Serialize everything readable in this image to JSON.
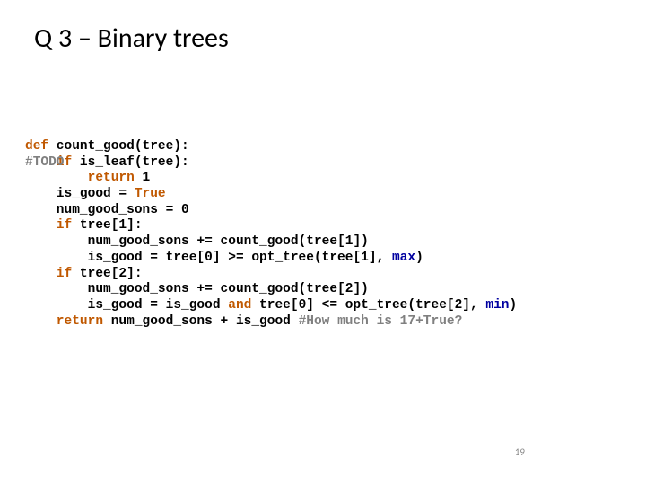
{
  "title": "Q 3 – Binary trees",
  "code": {
    "l1_def": "def",
    "l1_rest": " count_good(tree):",
    "l2_kw": "    if",
    "l2_rest": " is_leaf(tree):",
    "l2_overlay": "    #TODO",
    "l3_kw": "        return",
    "l3_rest": " 1",
    "l4_pre": "    is_good = ",
    "l4_kw": "True",
    "l5": "    num_good_sons = 0",
    "l6_kw": "    if",
    "l6_rest": " tree[1]:",
    "l7": "        num_good_sons += count_good(tree[1])",
    "l8_pre": "        is_good = tree[0] >= opt_tree(tree[1], ",
    "l8_kw": "max",
    "l8_post": ")",
    "l9_kw": "    if",
    "l9_rest": " tree[2]:",
    "l10": "        num_good_sons += count_good(tree[2])",
    "l11_pre": "        is_good = is_good ",
    "l11_and": "and",
    "l11_mid": " tree[0] <= opt_tree(tree[2], ",
    "l11_kw": "min",
    "l11_post": ")",
    "l12_kw": "    return",
    "l12_rest": " num_good_sons + is_good ",
    "l12_comment": "#How much is 17+True?"
  },
  "page_number": "19"
}
